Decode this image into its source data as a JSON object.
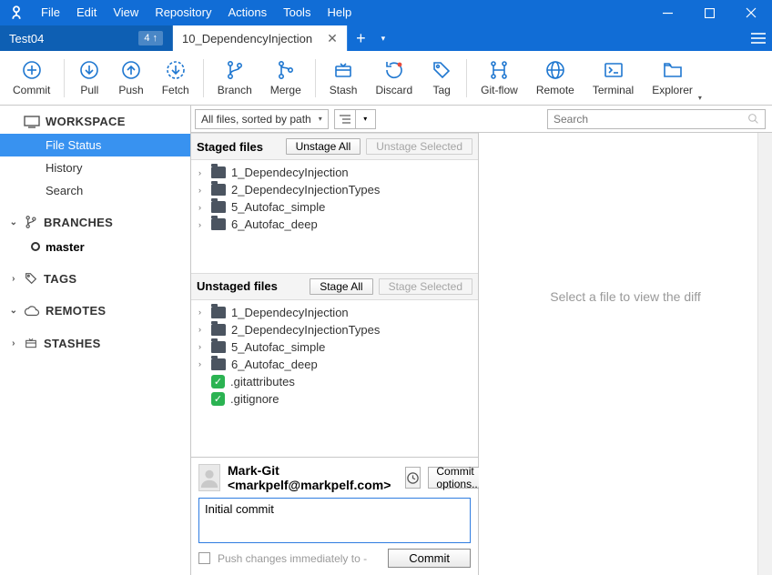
{
  "menu": {
    "file": "File",
    "edit": "Edit",
    "view": "View",
    "repository": "Repository",
    "actions": "Actions",
    "tools": "Tools",
    "help": "Help"
  },
  "tabs": {
    "inactive": {
      "label": "Test04",
      "badge": "4 ↑"
    },
    "active": {
      "label": "10_DependencyInjection"
    }
  },
  "toolbar": {
    "commit": "Commit",
    "pull": "Pull",
    "push": "Push",
    "fetch": "Fetch",
    "branch": "Branch",
    "merge": "Merge",
    "stash": "Stash",
    "discard": "Discard",
    "tag": "Tag",
    "gitflow": "Git-flow",
    "remote": "Remote",
    "terminal": "Terminal",
    "explorer": "Explorer"
  },
  "sidebar": {
    "workspace_label": "WORKSPACE",
    "workspace_items": {
      "file_status": "File Status",
      "history": "History",
      "search": "Search"
    },
    "branches_label": "BRANCHES",
    "branch_master": "master",
    "tags_label": "TAGS",
    "remotes_label": "REMOTES",
    "stashes_label": "STASHES"
  },
  "filterbar": {
    "filter_label": "All files, sorted by path",
    "search_placeholder": "Search"
  },
  "staged": {
    "title": "Staged files",
    "unstage_all": "Unstage All",
    "unstage_selected": "Unstage Selected",
    "items": [
      "1_DependecyInjection",
      "2_DependecyInjectionTypes",
      "5_Autofac_simple",
      "6_Autofac_deep"
    ]
  },
  "unstaged": {
    "title": "Unstaged files",
    "stage_all": "Stage All",
    "stage_selected": "Stage Selected",
    "folders": [
      "1_DependecyInjection",
      "2_DependecyInjectionTypes",
      "5_Autofac_simple",
      "6_Autofac_deep"
    ],
    "files": [
      ".gitattributes",
      ".gitignore"
    ]
  },
  "diff": {
    "placeholder": "Select a file to view the diff"
  },
  "commit": {
    "author": "Mark-Git <markpelf@markpelf.com>",
    "options_label": "Commit options...",
    "message": "Initial commit",
    "push_label": "Push changes immediately to -",
    "commit_btn": "Commit"
  }
}
